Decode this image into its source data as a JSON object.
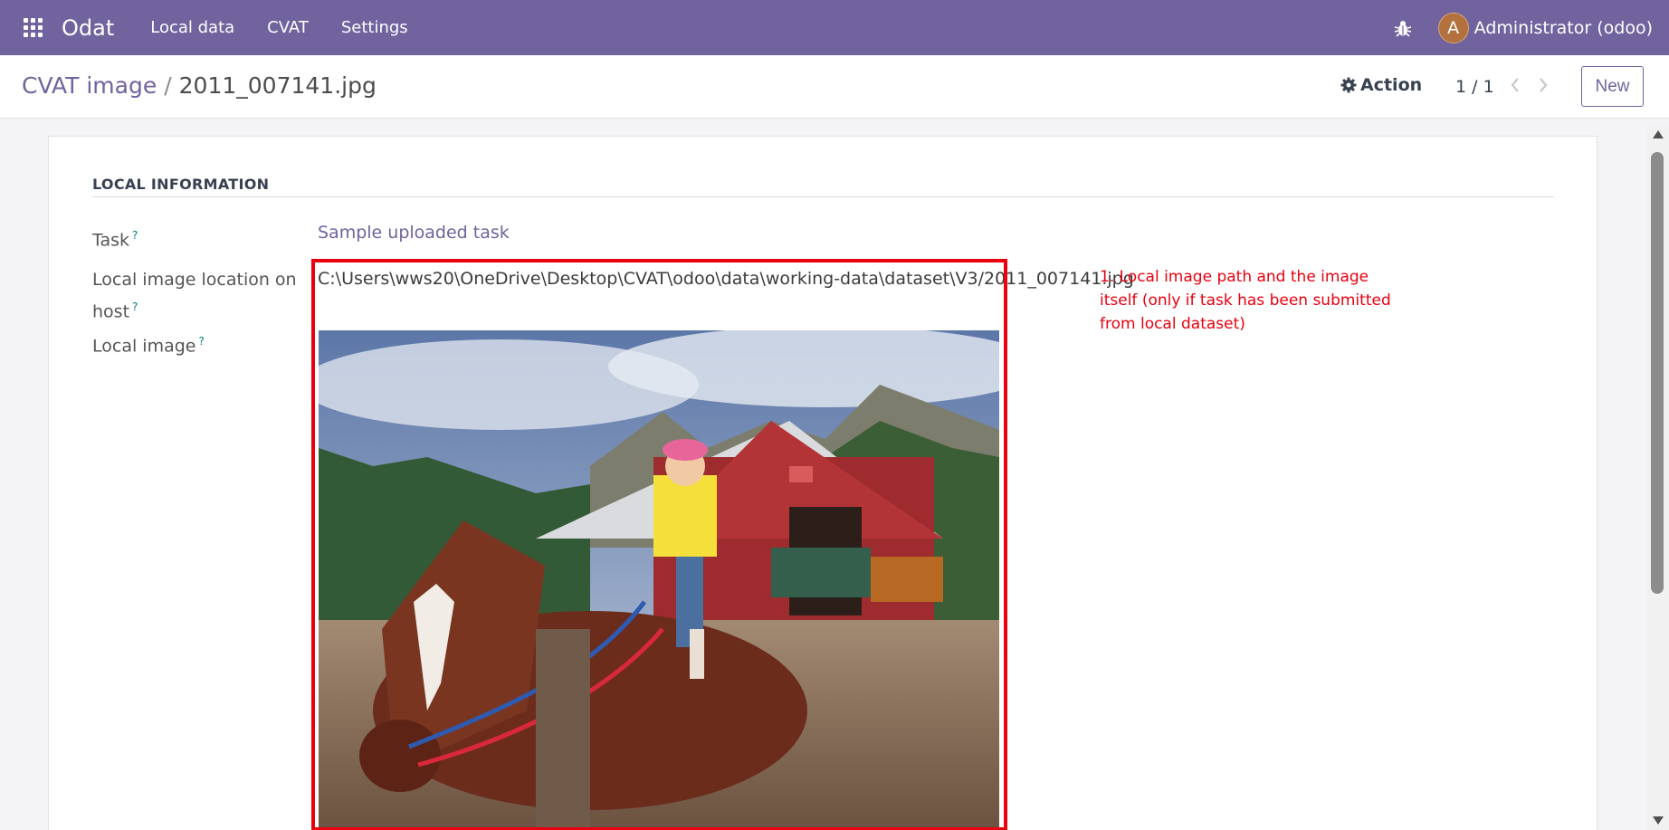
{
  "navbar": {
    "brand": "Odat",
    "menu": [
      {
        "label": "Local data"
      },
      {
        "label": "CVAT"
      },
      {
        "label": "Settings"
      }
    ],
    "user": {
      "initial": "A",
      "name": "Administrator (odoo)"
    },
    "icons": {
      "apps": "grid-apps-icon",
      "debug": "bug-icon"
    },
    "color": "#71639e"
  },
  "control_panel": {
    "breadcrumb": {
      "parent": "CVAT image",
      "separator": "/",
      "current": "2011_007141.jpg"
    },
    "action_label": "Action",
    "pager": "1 / 1",
    "new_label": "New"
  },
  "form": {
    "section_title": "LOCAL INFORMATION",
    "fields": {
      "task": {
        "label": "Task",
        "help": "?",
        "value": "Sample uploaded task"
      },
      "location": {
        "label_line1": "Local image location on",
        "label_line2": "host",
        "help": "?",
        "value": "C:\\Users\\wws20\\OneDrive\\Desktop\\CVAT\\odoo\\data\\working-data\\dataset\\V3/2011_007141.jpg"
      },
      "image": {
        "label": "Local image",
        "help": "?"
      }
    }
  },
  "annotation": {
    "text": "1. Local image path and the image itself (only if task has been submitted from local dataset)",
    "color": "#e8000f"
  }
}
